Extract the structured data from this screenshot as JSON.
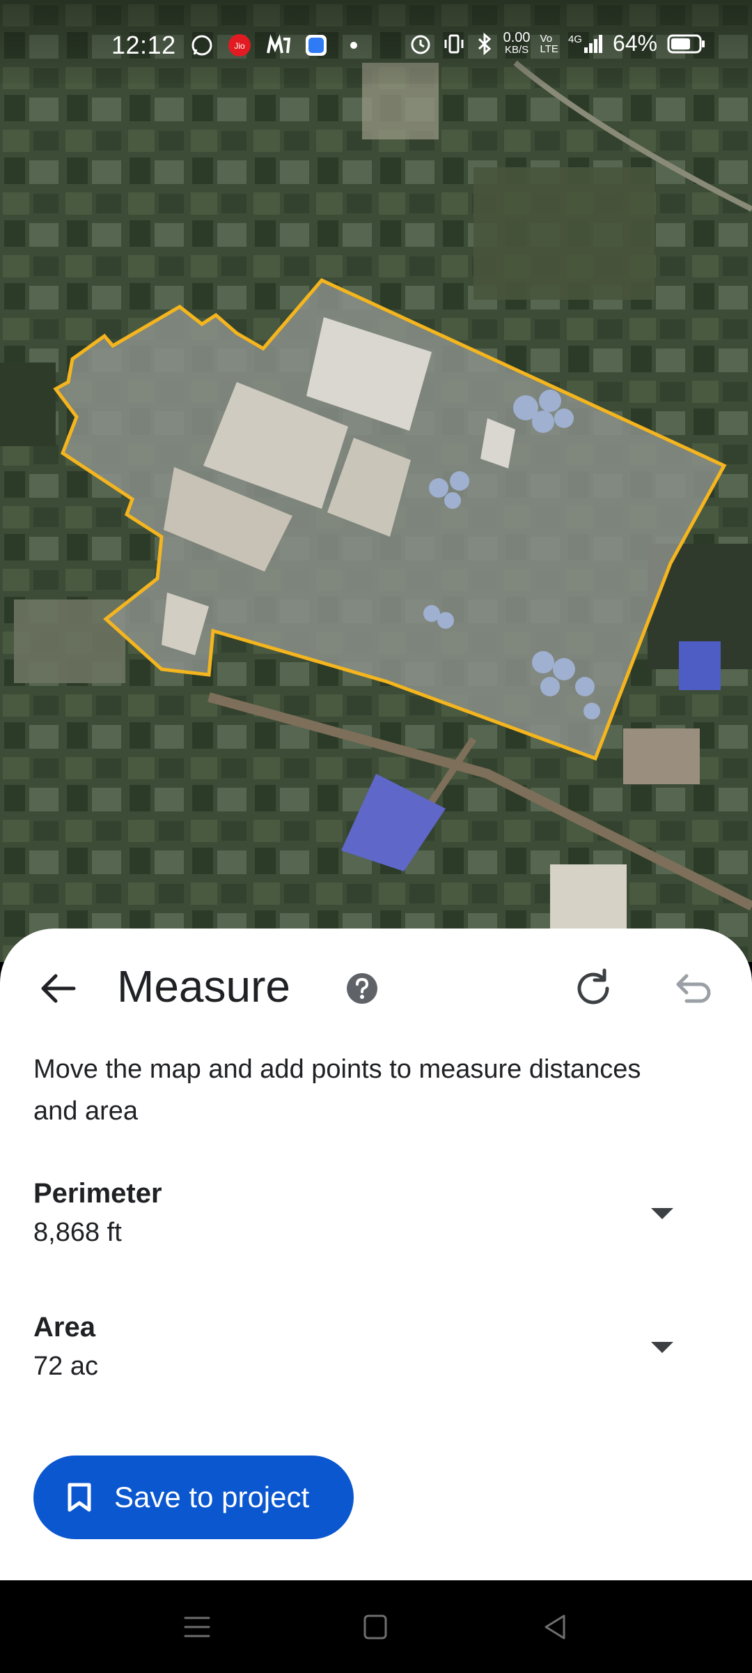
{
  "status_bar": {
    "time": "12:12",
    "app_icons": [
      "whatsapp-icon",
      "jio-icon",
      "myjio-icon",
      "messenger-icon",
      "dot-icon"
    ],
    "net_speed_value": "0.00",
    "net_speed_unit": "KB/S",
    "volte_top": "Vo",
    "volte_bottom": "LTE",
    "network": "4G",
    "battery_percent": "64%",
    "icons": [
      "alarm-icon",
      "vibrate-icon",
      "bluetooth-icon",
      "signal-icon",
      "battery-icon"
    ]
  },
  "map": {
    "view": "satellite",
    "measured_area_outline_color": "#f5b51e"
  },
  "sheet": {
    "title": "Measure",
    "instruction": "Move the map and add points to measure distances and area",
    "perimeter": {
      "label": "Perimeter",
      "value": "8,868 ft"
    },
    "area": {
      "label": "Area",
      "value": "72 ac"
    },
    "save_label": "Save to project",
    "accent_color": "#0b57d0"
  },
  "nav_bar": {
    "buttons": [
      "menu",
      "home",
      "back"
    ]
  }
}
